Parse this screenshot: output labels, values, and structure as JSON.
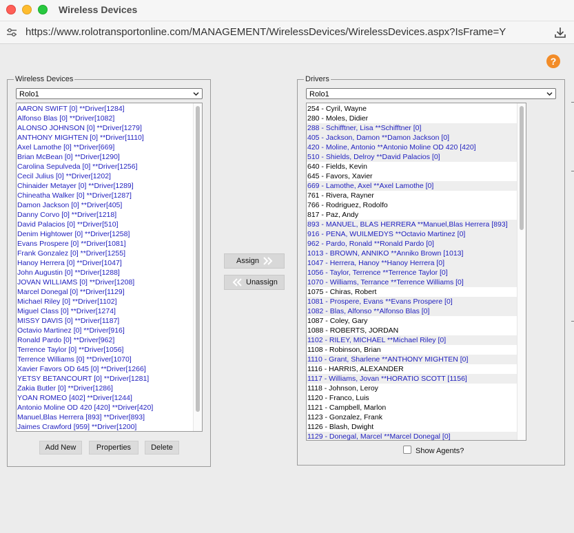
{
  "window": {
    "title": "Wireless Devices",
    "url": "https://www.rolotransportonline.com/MANAGEMENT/WirelessDevices/WirelessDevices.aspx?IsFrame=Y"
  },
  "help_label": "?",
  "wireless": {
    "legend": "Wireless Devices",
    "selected": "Rolo1",
    "items": [
      "AARON SWIFT [0] **Driver[1284]",
      "Alfonso Blas [0] **Driver[1082]",
      "ALONSO JOHNSON [0] **Driver[1279]",
      "ANTHONY MIGHTEN [0] **Driver[1110]",
      "Axel Lamothe [0] **Driver[669]",
      "Brian McBean [0] **Driver[1290]",
      "Carolina Sepulveda [0] **Driver[1256]",
      "Cecil Julius [0] **Driver[1202]",
      "Chinaider Metayer [0] **Driver[1289]",
      "Chineatha Walker [0] **Driver[1287]",
      "Damon Jackson [0] **Driver[405]",
      "Danny Corvo [0] **Driver[1218]",
      "David Palacios [0] **Driver[510]",
      "Denim Hightower [0] **Driver[1258]",
      "Evans Prospere [0] **Driver[1081]",
      "Frank Gonzalez [0] **Driver[1255]",
      "Hanoy Herrera [0] **Driver[1047]",
      "John Augustin [0] **Driver[1288]",
      "JOVAN WILLIAMS [0] **Driver[1208]",
      "Marcel Donegal [0] **Driver[1129]",
      "Michael Riley [0] **Driver[1102]",
      "Miguel Class [0] **Driver[1274]",
      "MISSY DAVIS [0] **Driver[1187]",
      "Octavio Martinez [0] **Driver[916]",
      "Ronald Pardo [0] **Driver[962]",
      "Terrence Taylor [0] **Driver[1056]",
      "Terrence Williams [0] **Driver[1070]",
      "Xavier Favors OD 645 [0] **Driver[1266]",
      "YETSY BETANCOURT [0] **Driver[1281]",
      "Zakia Butler [0] **Driver[1286]",
      "YOAN ROMEO [402] **Driver[1244]",
      "Antonio Moline OD 420 [420] **Driver[420]",
      "Manuel,Blas Herrera [893] **Driver[893]",
      "Jaimes Crawford [959] **Driver[1200]"
    ],
    "buttons": {
      "add": "Add New",
      "properties": "Properties",
      "delete": "Delete"
    }
  },
  "actions": {
    "assign": "Assign",
    "unassign": "Unassign"
  },
  "drivers": {
    "legend": "Drivers",
    "selected": "Rolo1",
    "items": [
      {
        "text": "254 - Cyril, Wayne",
        "assigned": false
      },
      {
        "text": "280 - Moles, Didier",
        "assigned": false
      },
      {
        "text": "288 - Schifftner, Lisa **Schifftner [0]",
        "assigned": true
      },
      {
        "text": "405 - Jackson, Damon **Damon Jackson [0]",
        "assigned": true
      },
      {
        "text": "420 - Moline, Antonio **Antonio Moline OD 420 [420]",
        "assigned": true
      },
      {
        "text": "510 - Shields, Delroy **David Palacios [0]",
        "assigned": true
      },
      {
        "text": "640 - Fields, Kevin",
        "assigned": false
      },
      {
        "text": "645 - Favors, Xavier",
        "assigned": false
      },
      {
        "text": "669 - Lamothe, Axel **Axel Lamothe [0]",
        "assigned": true
      },
      {
        "text": "761 - Rivera, Rayner",
        "assigned": false
      },
      {
        "text": "766 - Rodriguez, Rodolfo",
        "assigned": false
      },
      {
        "text": "817 - Paz, Andy",
        "assigned": false
      },
      {
        "text": "893 - MANUEL, BLAS HERRERA **Manuel,Blas Herrera [893]",
        "assigned": true
      },
      {
        "text": "916 - PENA, WUILMEDYS **Octavio Martinez [0]",
        "assigned": true
      },
      {
        "text": "962 - Pardo, Ronald **Ronald Pardo [0]",
        "assigned": true
      },
      {
        "text": "1013 - BROWN, ANNIKO **Anniko Brown [1013]",
        "assigned": true
      },
      {
        "text": "1047 - Herrera, Hanoy **Hanoy Herrera [0]",
        "assigned": true
      },
      {
        "text": "1056 - Taylor, Terrence **Terrence Taylor [0]",
        "assigned": true
      },
      {
        "text": "1070 - Williams, Terrance **Terrence Williams [0]",
        "assigned": true
      },
      {
        "text": "1075 - Chiras, Robert",
        "assigned": false
      },
      {
        "text": "1081 - Prospere, Evans **Evans Prospere [0]",
        "assigned": true
      },
      {
        "text": "1082 - Blas, Alfonso **Alfonso Blas [0]",
        "assigned": true
      },
      {
        "text": "1087 - Coley, Gary",
        "assigned": false
      },
      {
        "text": "1088 - ROBERTS, JORDAN",
        "assigned": false
      },
      {
        "text": "1102 - RILEY, MICHAEL **Michael Riley [0]",
        "assigned": true
      },
      {
        "text": "1108 - Robinson, Brian",
        "assigned": false
      },
      {
        "text": "1110 - Grant, Sharlene **ANTHONY MIGHTEN [0]",
        "assigned": true
      },
      {
        "text": "1116 - HARRIS, ALEXANDER",
        "assigned": false
      },
      {
        "text": "1117 - Williams, Jovan **HORATIO SCOTT [1156]",
        "assigned": true
      },
      {
        "text": "1118 - Johnson, Leroy",
        "assigned": false
      },
      {
        "text": "1120 - Franco, Luis",
        "assigned": false
      },
      {
        "text": "1121 - Campbell, Marlon",
        "assigned": false
      },
      {
        "text": "1123 - Gonzalez, Frank",
        "assigned": false
      },
      {
        "text": "1126 - Blash, Dwight",
        "assigned": false
      },
      {
        "text": "1129 - Donegal, Marcel **Marcel Donegal [0]",
        "assigned": true
      }
    ],
    "show_agents_label": "Show Agents?"
  },
  "colors": {
    "assigned_text": "#1e1ebe",
    "help_orange": "#f28c28"
  },
  "icons": [
    "site-settings-icon",
    "download-icon",
    "double-chevron-right-icon",
    "double-chevron-left-icon"
  ]
}
